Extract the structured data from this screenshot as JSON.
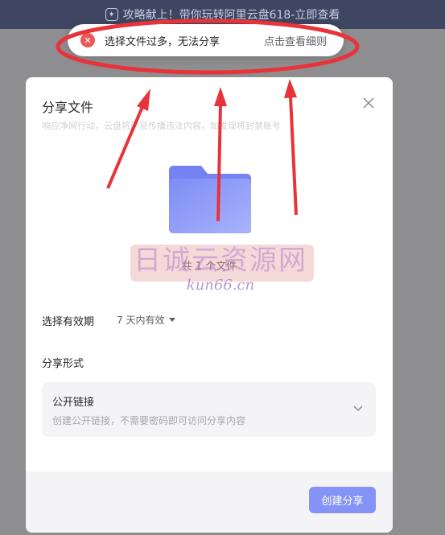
{
  "banner": {
    "text": "攻略献上！带你玩转阿里云盘618-立即查看",
    "icon": "gift-icon"
  },
  "toast": {
    "icon": "error-icon",
    "message": "选择文件过多，无法分享",
    "link": "点击查看细则"
  },
  "dialog": {
    "title": "分享文件",
    "subtitle": "响应净网行动，云盘将严惩传播违法内容，如发现将封禁账号",
    "close_icon": "close-icon",
    "folder_icon": "folder-icon",
    "file_count": "共 1 个文件",
    "expiry": {
      "label": "选择有效期",
      "value": "7 天内有效"
    },
    "share_type": {
      "label": "分享形式",
      "option_title": "公开链接",
      "option_desc": "创建公开链接，不需要密码即可访问分享内容"
    },
    "create_button": "创建分享"
  },
  "watermark": {
    "main": "日诚云资源网",
    "sub": "kun66.cn"
  },
  "colors": {
    "accent": "#8593f7",
    "annotation": "#e8333a",
    "error": "#e85a5a",
    "banner": "#3e4661"
  }
}
